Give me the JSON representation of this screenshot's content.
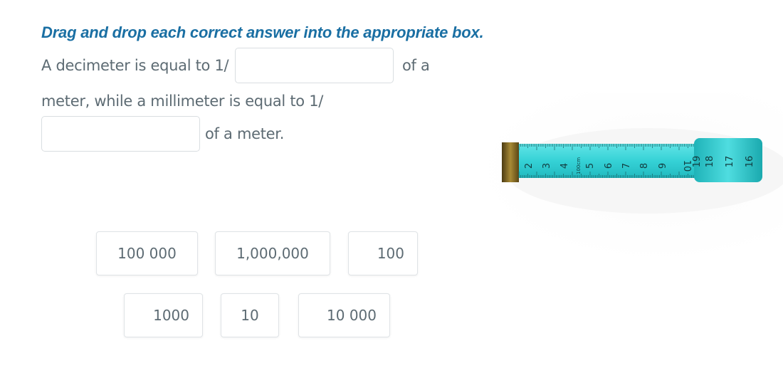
{
  "instruction": "Drag and drop each correct answer into the appropriate box.",
  "sentence": {
    "part1": "A decimeter is equal to 1/",
    "part2": "of a",
    "part3": "meter, while a millimeter is equal to 1/",
    "part4": "of a meter."
  },
  "tiles": [
    "100 000",
    "1,000,000",
    "100",
    "1000",
    "10",
    "10 000"
  ],
  "tape_labels": {
    "numbers": [
      "2",
      "3",
      "4",
      "5",
      "6",
      "7",
      "8",
      "9",
      "10",
      "18",
      "17",
      "16"
    ],
    "small": "100cm",
    "mid": "19"
  },
  "colors": {
    "instruction": "#1a6fa3",
    "text": "#5d6b73",
    "tape": "#35d2d6",
    "tape_end": "#8a6a1e"
  }
}
